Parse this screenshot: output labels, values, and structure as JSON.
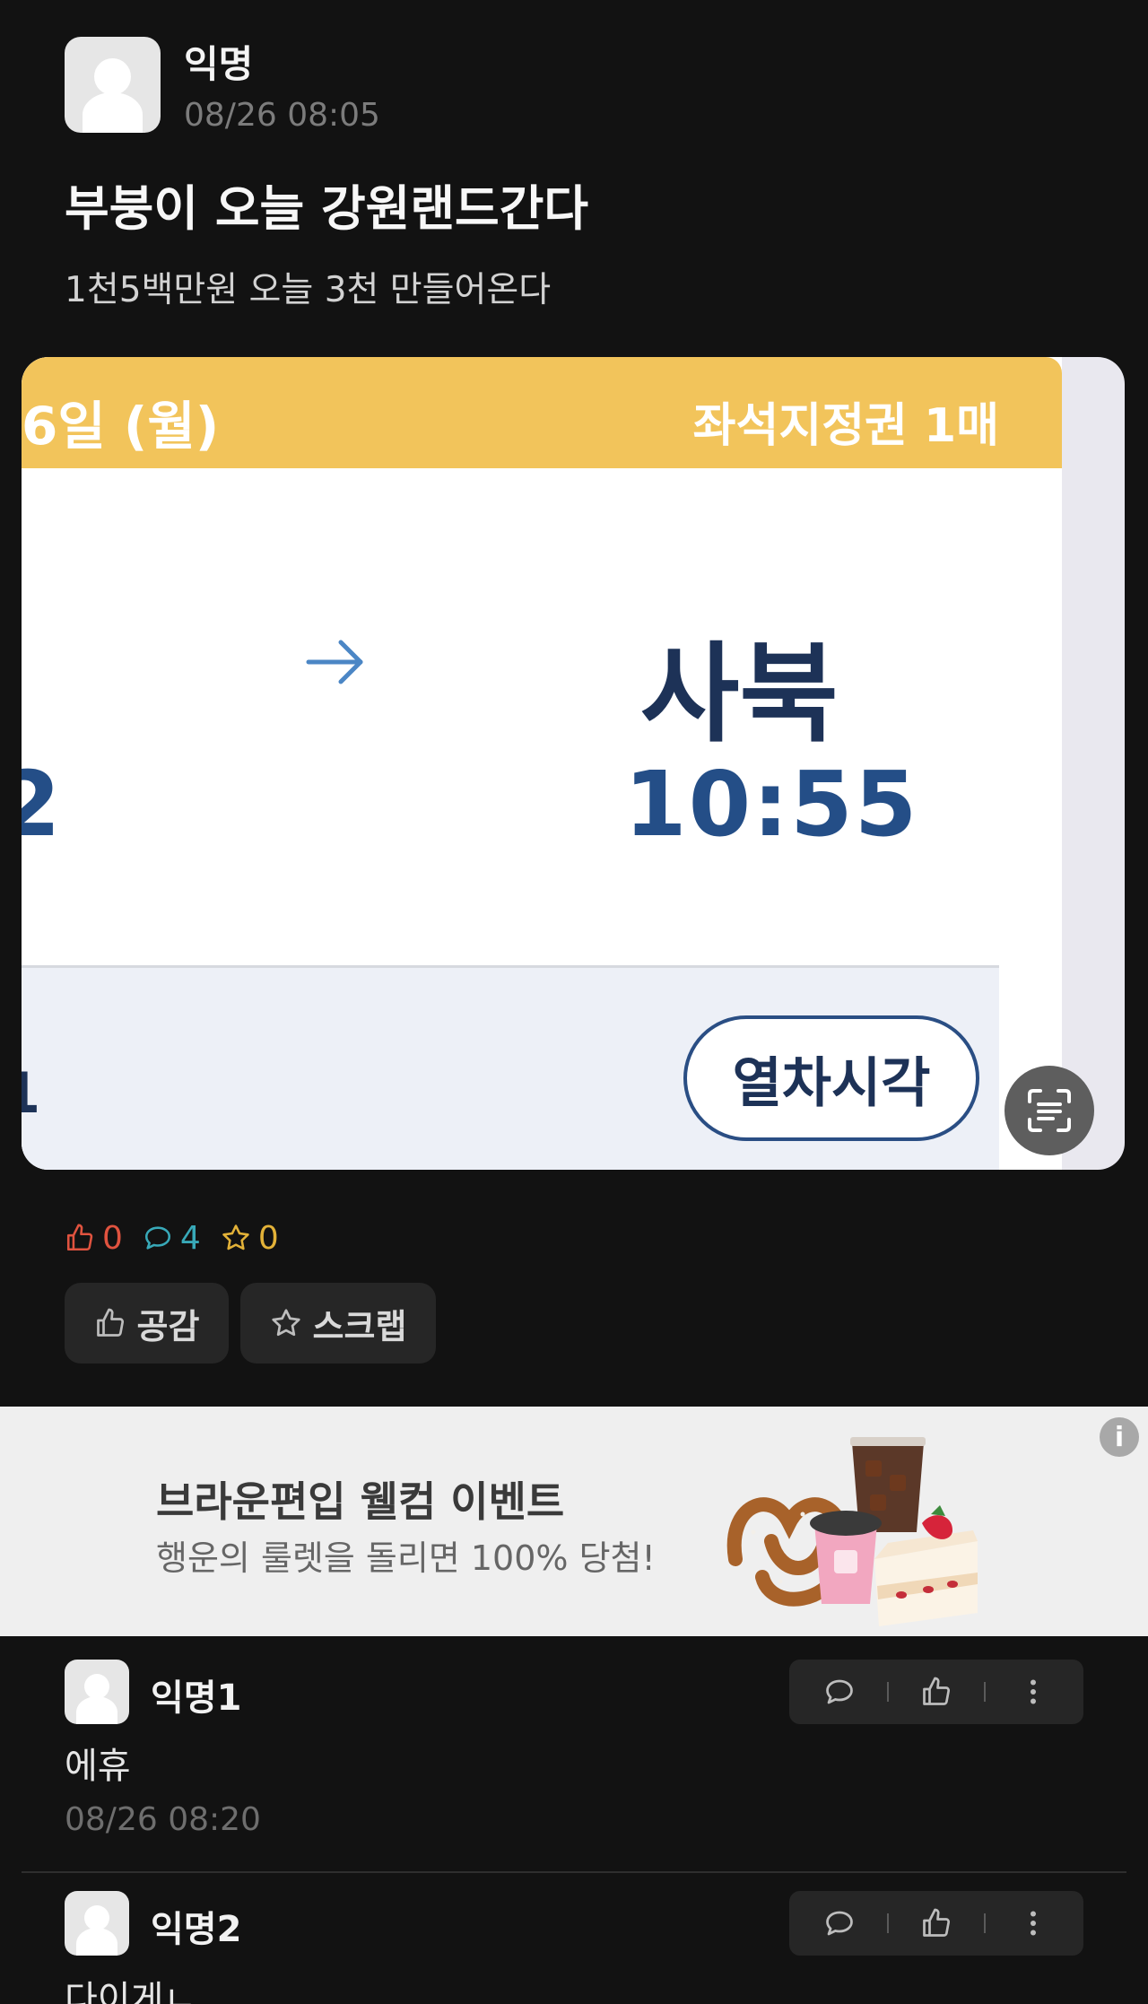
{
  "post": {
    "author": "익명",
    "time": "08/26 08:05",
    "title": "부붕이 오늘 강원랜드간다",
    "body": "1천5백만원 오늘 3천 만들어온다"
  },
  "ticket_image": {
    "date_fragment": "6일 (월)",
    "seat_info": "좌석지정권 1매",
    "arrival_station": "사북",
    "arrival_time": "10:55",
    "departure_time_fragment": "2",
    "footer_fragment": "1",
    "timetable_button": "열차시각"
  },
  "stats": {
    "likes": "0",
    "comments": "4",
    "scraps": "0"
  },
  "actions": {
    "like_label": "공감",
    "scrap_label": "스크랩"
  },
  "ad": {
    "headline": "브라운편입 웰컴 이벤트",
    "subline": "행운의 룰렛을 돌리면 100% 당첨!",
    "info_icon": "i"
  },
  "comments": [
    {
      "author": "익명1",
      "text": "에휴",
      "time": "08/26 08:20"
    },
    {
      "author": "익명2",
      "text": "다이게ㄴ",
      "time": ""
    }
  ],
  "colors": {
    "background": "#121212",
    "like_red": "#e0533f",
    "comment_teal": "#38a9b8",
    "scrap_yellow": "#e3b238",
    "ticket_yellow": "#f2c45b",
    "ticket_navy": "#1d3257"
  }
}
